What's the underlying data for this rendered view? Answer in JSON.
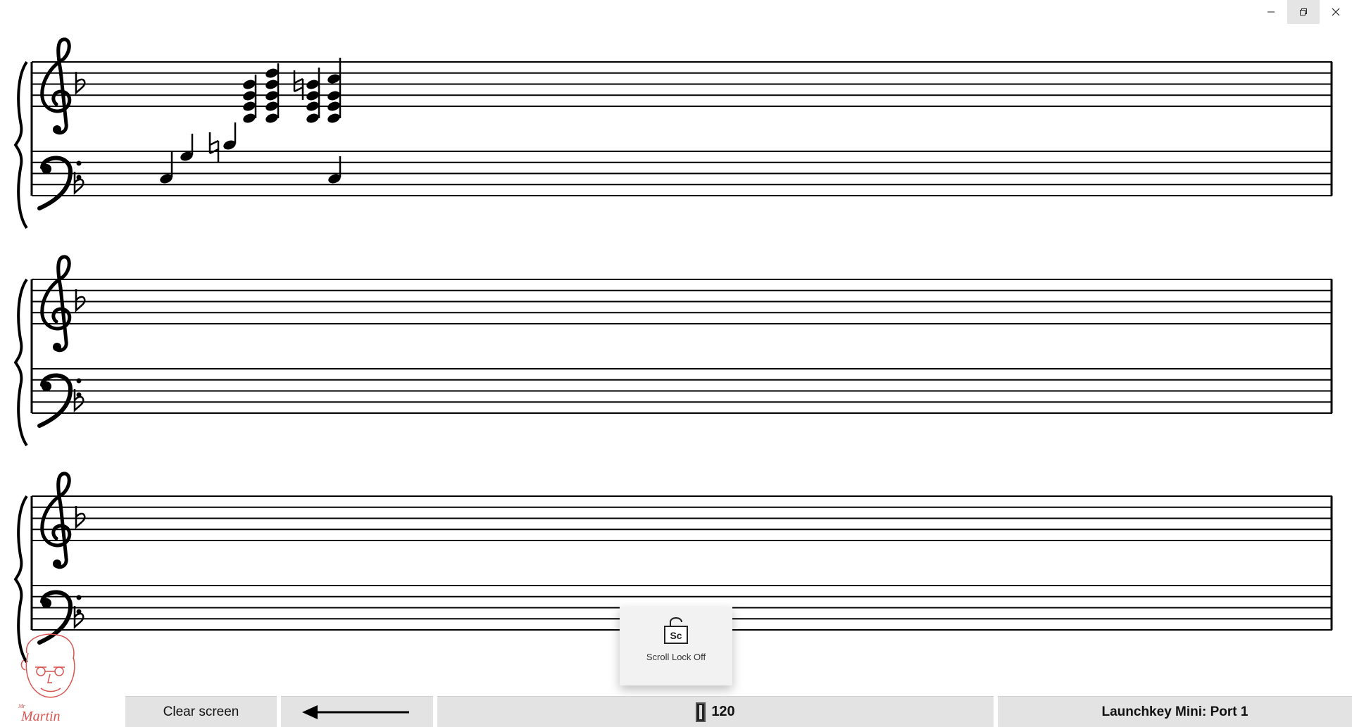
{
  "window": {
    "controls": [
      {
        "name": "minimize-icon",
        "glyph": "–"
      },
      {
        "name": "restore-icon",
        "glyph": "❐"
      },
      {
        "name": "close-icon",
        "glyph": "✕"
      }
    ]
  },
  "score": {
    "systems": 3,
    "key_signature": "F major (1 flat)",
    "clefs": [
      "treble-clef-icon",
      "bass-clef-icon"
    ]
  },
  "popup": {
    "icon_text": "Sc",
    "label": "Scroll Lock Off"
  },
  "logo": {
    "text_small": "Mr",
    "text_main": "Martin"
  },
  "status_bar": {
    "clear_label": "Clear screen",
    "back_arrow_icon": "left-arrow-icon",
    "tempo_value": "120",
    "device_label": "Launchkey Mini: Port 1"
  },
  "colors": {
    "background": "#ffffff",
    "ink": "#000000",
    "status_bar": "#e3e3e3",
    "popup": "#f2f2f2",
    "logo": "#d9534f"
  }
}
